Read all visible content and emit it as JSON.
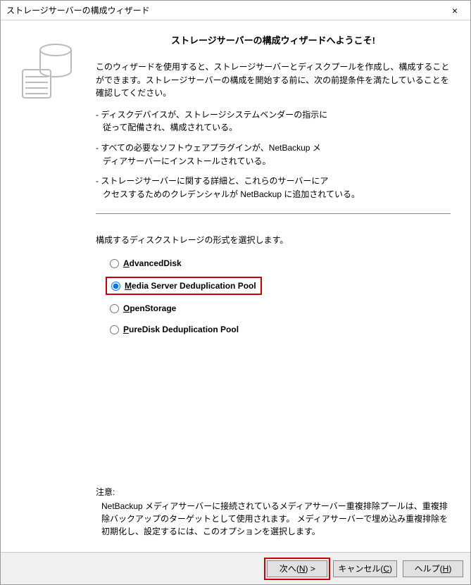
{
  "window": {
    "title": "ストレージサーバーの構成ウィザード",
    "close_icon": "×"
  },
  "welcome": "ストレージサーバーの構成ウィザードへようこそ!",
  "intro": "このウィザードを使用すると、ストレージサーバーとディスクプールを作成し、構成することができます。ストレージサーバーの構成を開始する前に、次の前提条件を満たしていることを確認してください。",
  "bullets": [
    {
      "lead": "- ディスクデバイスが、ストレージシステムベンダーの指示に",
      "rest": "従って配備され、構成されている。"
    },
    {
      "lead": "- すべての必要なソフトウェアプラグインが、NetBackup メ",
      "rest": "ディアサーバーにインストールされている。"
    },
    {
      "lead": "- ストレージサーバーに関する詳細と、これらのサーバーにア",
      "rest": "クセスするためのクレデンシャルが NetBackup に追加されている。"
    }
  ],
  "select_label": "構成するディスクストレージの形式を選択します。",
  "options": [
    {
      "id": "opt-advanced",
      "mnemonic": "A",
      "label_rest": "dvancedDisk",
      "selected": false,
      "highlighted": false
    },
    {
      "id": "opt-msdp",
      "mnemonic": "M",
      "label_rest": "edia Server Deduplication Pool",
      "selected": true,
      "highlighted": true
    },
    {
      "id": "opt-openstorage",
      "mnemonic": "O",
      "label_rest": "penStorage",
      "selected": false,
      "highlighted": false
    },
    {
      "id": "opt-puredisk",
      "mnemonic": "P",
      "label_rest": "ureDisk Deduplication Pool",
      "selected": false,
      "highlighted": false
    }
  ],
  "note": {
    "title": "注意:",
    "body": "NetBackup メディアサーバーに接続されているメディアサーバー重複排除プールは、重複排除バックアップのターゲットとして使用されます。 メディアサーバーで埋め込み重複排除を初期化し、設定するには、このオプションを選択します。"
  },
  "buttons": {
    "next": {
      "pre": "次へ(",
      "mnemonic": "N",
      "post": ") >"
    },
    "cancel": {
      "pre": "キャンセル(",
      "mnemonic": "C",
      "post": ")"
    },
    "help": {
      "pre": "ヘルプ(",
      "mnemonic": "H",
      "post": ")"
    }
  }
}
